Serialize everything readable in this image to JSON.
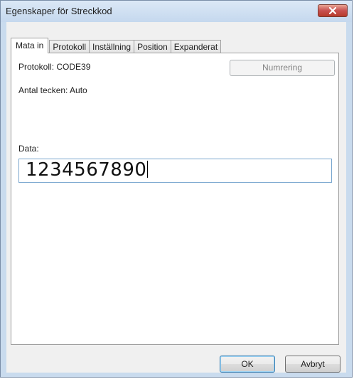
{
  "window": {
    "title": "Egenskaper för Streckkod"
  },
  "tabs": [
    {
      "label": "Mata in",
      "active": true
    },
    {
      "label": "Protokoll",
      "active": false
    },
    {
      "label": "Inställning",
      "active": false
    },
    {
      "label": "Position",
      "active": false
    },
    {
      "label": "Expanderat",
      "active": false
    }
  ],
  "panel": {
    "protocol_label": "Protokoll: CODE39",
    "char_count_label": "Antal tecken: Auto",
    "numbering_button": "Numrering",
    "data_label": "Data:",
    "data_value": "1234567890"
  },
  "footer": {
    "ok_label": "OK",
    "cancel_label": "Avbryt"
  },
  "colors": {
    "titlebar": "#c5d8ee",
    "close_button": "#c75050",
    "panel_bg": "#ffffff",
    "input_border": "#7aa7cf"
  },
  "icons": {
    "close": "close-icon"
  }
}
